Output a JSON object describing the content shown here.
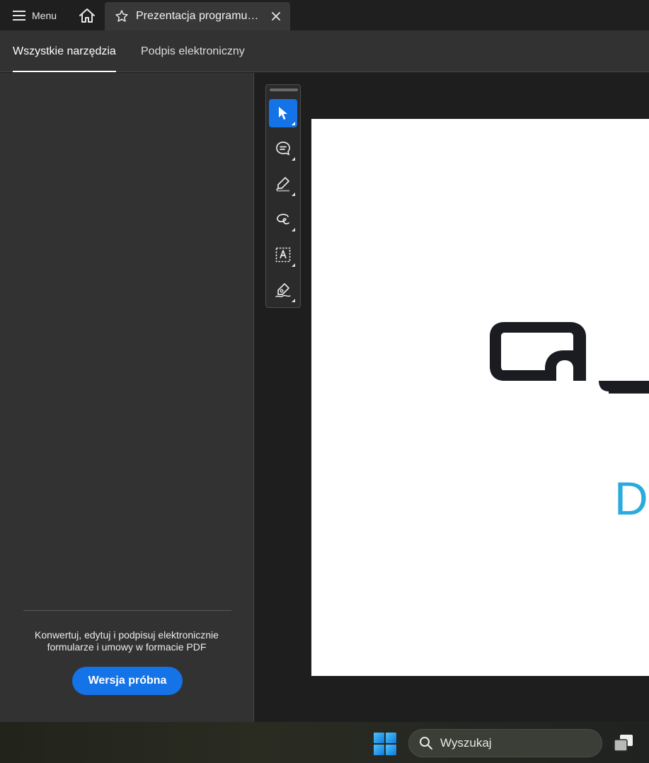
{
  "titlebar": {
    "menu_label": "Menu",
    "tab_title": "Prezentacja programu…"
  },
  "tool_tabs": [
    {
      "label": "Wszystkie narzędzia",
      "active": true
    },
    {
      "label": "Podpis elektroniczny",
      "active": false
    }
  ],
  "left_panel": {
    "promo_line1": "Konwertuj, edytuj i podpisuj elektronicznie",
    "promo_line2": "formularze i umowy w formacie PDF",
    "trial_button": "Wersja próbna"
  },
  "quick_tools": [
    {
      "icon": "select-cursor-icon",
      "selected": true
    },
    {
      "icon": "add-comment-icon",
      "selected": false
    },
    {
      "icon": "highlight-pen-icon",
      "selected": false
    },
    {
      "icon": "draw-freehand-icon",
      "selected": false
    },
    {
      "icon": "add-text-icon",
      "selected": false
    },
    {
      "icon": "fill-sign-icon",
      "selected": false
    }
  ],
  "document": {
    "visible_letter": "D"
  },
  "taskbar": {
    "search_placeholder": "Wyszukaj"
  },
  "colors": {
    "accent": "#1473e6",
    "logo_cyan": "#2aabdc",
    "logo_dark": "#1b1b22"
  }
}
